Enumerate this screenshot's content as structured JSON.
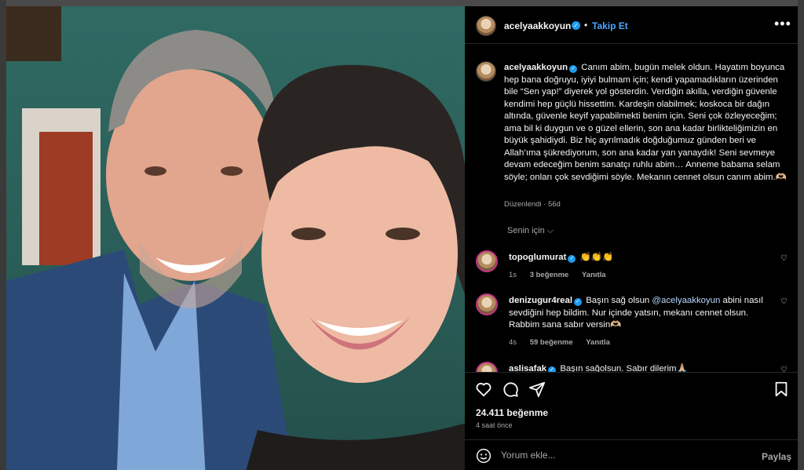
{
  "post": {
    "author": "acelyaakkoyun",
    "follow_label": "Takip Et",
    "dot": "•",
    "more": "•••",
    "caption": "Canım abim, bugün melek oldun. Hayatım boyunca hep bana doğruyu, iyiyi bulmam için; kendi yapamadıkların üzerinden bile “Sen yap!” diyerek yol gösterdin. Verdiğin akılla, verdiğin güvenle kendimi hep güçlü hissettim. Kardeşin olabilmek; koskoca bir dağın altında, güvenle keyif yapabilmekti benim için. Seni çok özleyeceğim; ama bil ki duygun ve o güzel ellerin, son ana kadar birlikteliğimizin en büyük şahidiydi. Biz hiç ayrılmadık doğduğumuz günden beri ve Allah’ıma şükrediyorum, son ana kadar yan yanaydık! Seni sevmeye devam edeceğim benim sanatçı ruhlu abim… Anneme babama selam söyle; onları çok sevdiğimi söyle. Mekanın cennet olsun canım abim.🫶🏼",
    "edited": "Düzenlendi · 56d",
    "filter_label": "Senin için ⌵",
    "likes": "24.411 beğenme",
    "time_ago": "4 saat önce",
    "comment_placeholder": "Yorum ekle...",
    "share_label": "Paylaş"
  },
  "comments": [
    {
      "user": "topoglumurat",
      "text": "👏👏👏",
      "time": "1s",
      "likes": "3 beğenme",
      "reply": "Yanıtla"
    },
    {
      "user": "denizugur4real",
      "text_before": "Başın sağ olsun ",
      "mention": "@acelyaakkoyun",
      "text_after": " abini nasıl sevdiğini hep bildim. Nur içinde yatsın, mekanı cennet olsun. Rabbim sana sabır versin🫶🏼",
      "time": "4s",
      "likes": "59 beğenme",
      "reply": "Yanıtla"
    },
    {
      "user": "aslisafak",
      "text": "Başın sağolsun. Sabır dilerim🙏🏼"
    }
  ],
  "icons": {
    "verified": "✓",
    "heart": "♡"
  },
  "colors": {
    "panel_bg": "#000000",
    "link_blue": "#4da6ff",
    "verified": "#1d9bf0",
    "muted": "#a8a8a8"
  }
}
